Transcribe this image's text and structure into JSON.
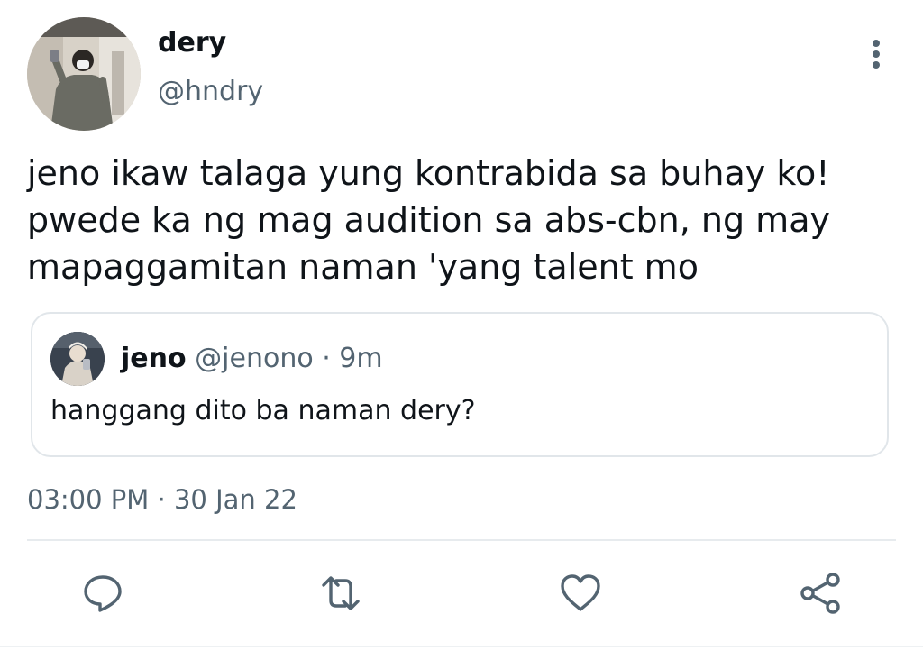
{
  "tweet": {
    "author": {
      "display_name": "dery",
      "handle": "@hndry"
    },
    "text": "jeno ikaw talaga yung kontrabida sa buhay ko!\npwede ka ng mag audition sa abs-cbn, ng may\nmapaggamitan naman 'yang talent mo",
    "timestamp": "03:00 PM · 30 Jan 22"
  },
  "quoted_tweet": {
    "display_name": "jeno",
    "handle": "@jenono",
    "time_ago": "· 9m",
    "text": "hanggang dito ba naman dery?"
  },
  "actions": [
    {
      "name": "reply",
      "icon": "reply-icon"
    },
    {
      "name": "retweet",
      "icon": "retweet-icon"
    },
    {
      "name": "like",
      "icon": "heart-icon"
    },
    {
      "name": "share",
      "icon": "share-icon"
    }
  ],
  "colors": {
    "primary_text": "#0f1419",
    "secondary_text": "#536471",
    "border": "#e1e6ea",
    "icon": "#536471"
  }
}
